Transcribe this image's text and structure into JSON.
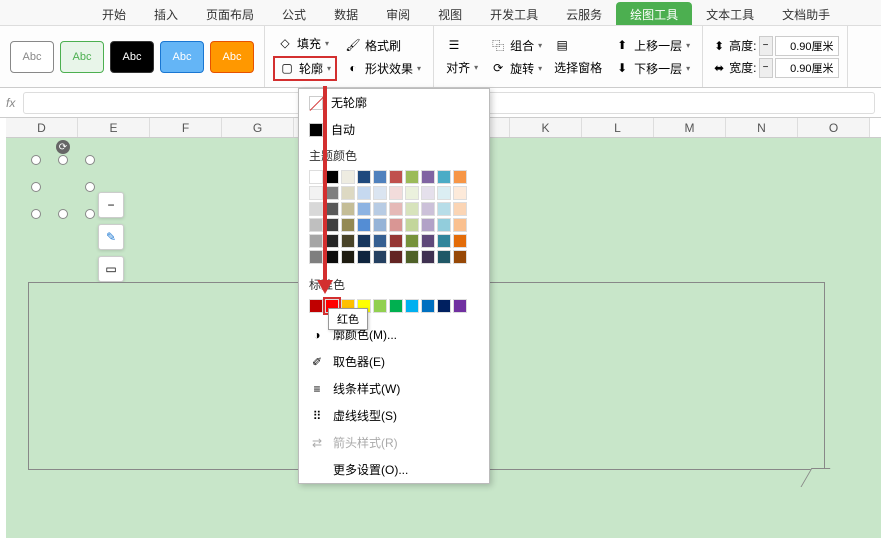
{
  "tabs": [
    "开始",
    "插入",
    "页面布局",
    "公式",
    "数据",
    "审阅",
    "视图",
    "开发工具",
    "云服务",
    "绘图工具",
    "文本工具",
    "文档助手"
  ],
  "active_tab_index": 9,
  "shape_label": "Abc",
  "ribbon": {
    "fill": "填充",
    "format_painter": "格式刷",
    "outline": "轮廓",
    "shape_effects": "形状效果",
    "align": "对齐",
    "group": "组合",
    "rotate": "旋转",
    "selection_pane": "选择窗格",
    "bring_forward": "上移一层",
    "send_backward": "下移一层",
    "height_label": "高度:",
    "width_label": "宽度:",
    "height_value": "0.90厘米",
    "width_value": "0.90厘米"
  },
  "dropdown": {
    "no_outline": "无轮廓",
    "automatic": "自动",
    "theme_colors_label": "主题颜色",
    "standard_colors_label": "标准色",
    "more_colors": "廓颜色(M)...",
    "eyedropper": "取色器(E)",
    "line_style": "线条样式(W)",
    "dash_type": "虚线线型(S)",
    "arrow_style": "箭头样式(R)",
    "more_settings": "更多设置(O)..."
  },
  "tooltip_text": "红色",
  "theme_colors": [
    [
      "#ffffff",
      "#000000",
      "#eeece1",
      "#1f497d",
      "#4f81bd",
      "#c0504d",
      "#9bbb59",
      "#8064a2",
      "#4bacc6",
      "#f79646"
    ],
    [
      "#f2f2f2",
      "#7f7f7f",
      "#ddd9c3",
      "#c6d9f0",
      "#dbe5f1",
      "#f2dcdb",
      "#ebf1dd",
      "#e5e0ec",
      "#dbeef3",
      "#fdeada"
    ],
    [
      "#d8d8d8",
      "#595959",
      "#c4bd97",
      "#8db3e2",
      "#b8cce4",
      "#e5b9b7",
      "#d7e3bc",
      "#ccc1d9",
      "#b7dde8",
      "#fbd5b5"
    ],
    [
      "#bfbfbf",
      "#3f3f3f",
      "#938953",
      "#548dd4",
      "#95b3d7",
      "#d99694",
      "#c3d69b",
      "#b2a2c7",
      "#92cddc",
      "#fac08f"
    ],
    [
      "#a5a5a5",
      "#262626",
      "#494429",
      "#17365d",
      "#366092",
      "#953734",
      "#76923c",
      "#5f497a",
      "#31859b",
      "#e36c09"
    ],
    [
      "#7f7f7f",
      "#0c0c0c",
      "#1d1b10",
      "#0f243e",
      "#244061",
      "#632423",
      "#4f6128",
      "#3f3151",
      "#205867",
      "#974806"
    ]
  ],
  "standard_colors": [
    "#c00000",
    "#ff0000",
    "#ffc000",
    "#ffff00",
    "#92d050",
    "#00b050",
    "#00b0f0",
    "#0070c0",
    "#002060",
    "#7030a0"
  ],
  "highlighted_std_index": 1,
  "columns": [
    "D",
    "E",
    "F",
    "G",
    "",
    "",
    "",
    "K",
    "L",
    "M",
    "N",
    "O"
  ]
}
